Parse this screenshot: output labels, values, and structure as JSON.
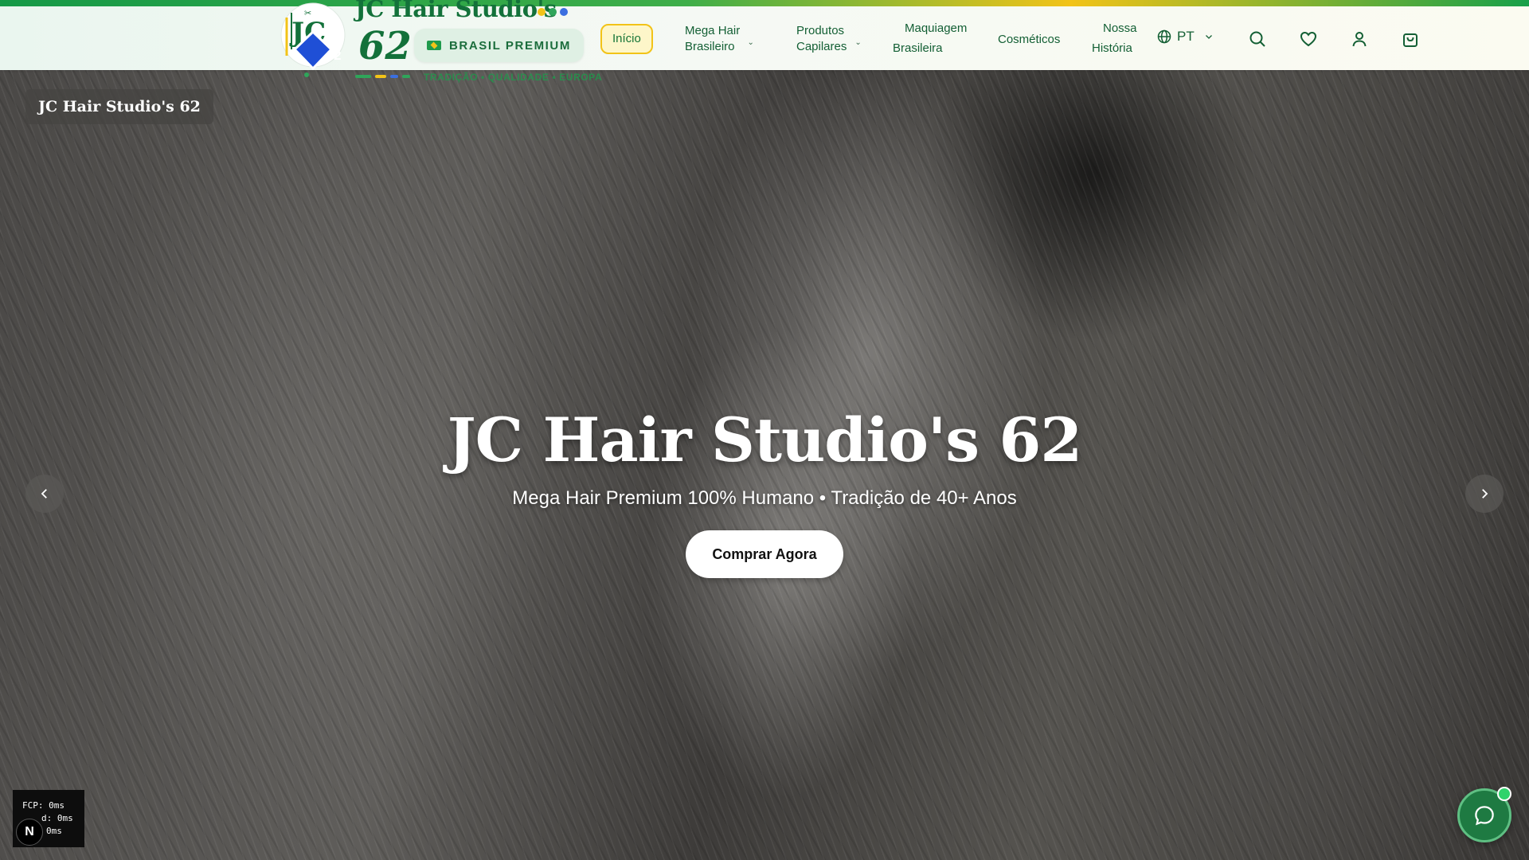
{
  "brand": {
    "name": "JC Hair Studio's",
    "number": "62",
    "badge_number": "62",
    "initials": "JC",
    "premium_label": "BRASIL PREMIUM",
    "tagline": "TRADIÇÃO • QUALIDADE • EUROPA"
  },
  "nav": {
    "items": [
      {
        "label": "Início",
        "active": true
      },
      {
        "line1": "Mega Hair",
        "line2": "Brasileiro",
        "has_dropdown": true
      },
      {
        "line1": "Produtos",
        "line2": "Capilares",
        "has_dropdown": true
      },
      {
        "line1": "Maquiagem",
        "line2": "Brasileira"
      },
      {
        "label": "Cosméticos"
      },
      {
        "line1": "Nossa",
        "line2": "História"
      }
    ],
    "language": "PT",
    "icons": [
      "globe-icon",
      "search-icon",
      "heart-icon",
      "user-icon",
      "shopping-bag-icon"
    ]
  },
  "hero": {
    "badge": "JC Hair Studio's 62",
    "title": "JC Hair Studio's 62",
    "subtitle": "Mega Hair Premium 100% Humano • Tradição de 40+ Anos",
    "cta": "Comprar Agora"
  },
  "perf": {
    "line1": "FCP: 0ms",
    "line2": "d: 0ms",
    "line3": "0ms",
    "badge": "N"
  },
  "colors": {
    "brand_green": "#13713a",
    "accent_yellow": "#f2c318",
    "badge_blue": "#1f4fd6",
    "chat_green": "#1e7a42"
  }
}
